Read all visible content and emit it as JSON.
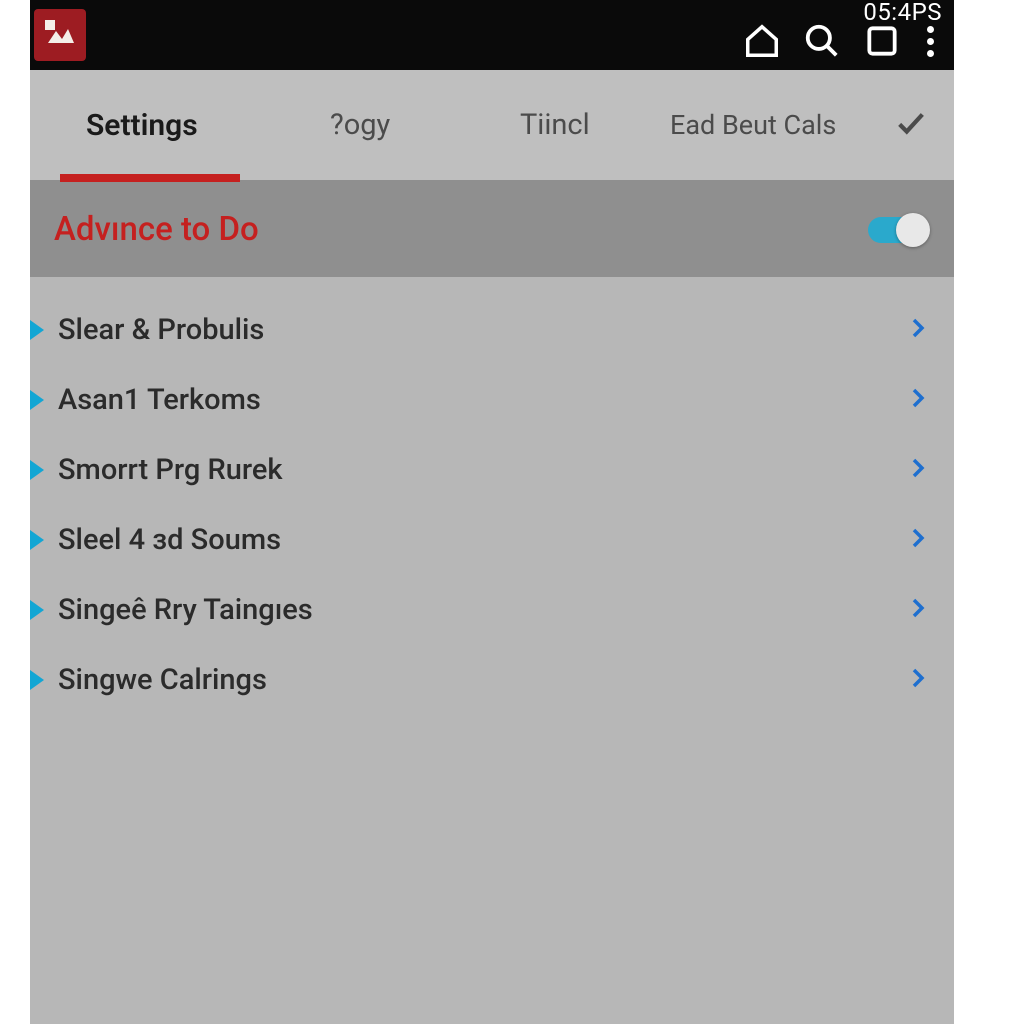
{
  "status": {
    "time": "05:4PS"
  },
  "tabs": {
    "settings": "Settings",
    "ogy": "?ogy",
    "tincl": "Tiincl",
    "ead": "Ead Beut Cals"
  },
  "section": {
    "title": "Advınce to Do"
  },
  "items": [
    "Slear & Probulis",
    "Asan1 Terkoms",
    "Smorrt Prg Rurek",
    "Sleel 4 зd Soums",
    "Singeê Rry Taingıes",
    "Singwe Calrings"
  ]
}
